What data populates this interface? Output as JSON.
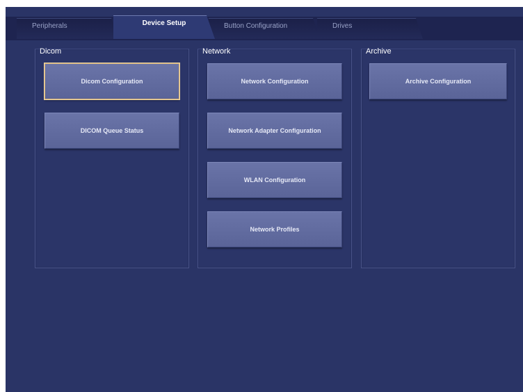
{
  "tabs": [
    {
      "label": "Peripherals",
      "active": false
    },
    {
      "label": "Device Setup",
      "active": true
    },
    {
      "label": "Button Configuration",
      "active": false
    },
    {
      "label": "Drives",
      "active": false
    }
  ],
  "groups": {
    "dicom": {
      "label": "Dicom",
      "buttons": [
        "Dicom Configuration",
        "DICOM Queue Status"
      ]
    },
    "network": {
      "label": "Network",
      "buttons": [
        "Network Configuration",
        "Network Adapter Configuration",
        "WLAN Configuration",
        "Network Profiles"
      ]
    },
    "archive": {
      "label": "Archive",
      "buttons": [
        "Archive Configuration"
      ]
    }
  },
  "colors": {
    "background": "#2a3466",
    "button": "#6a74a8",
    "focus_border": "#d8b47a"
  }
}
